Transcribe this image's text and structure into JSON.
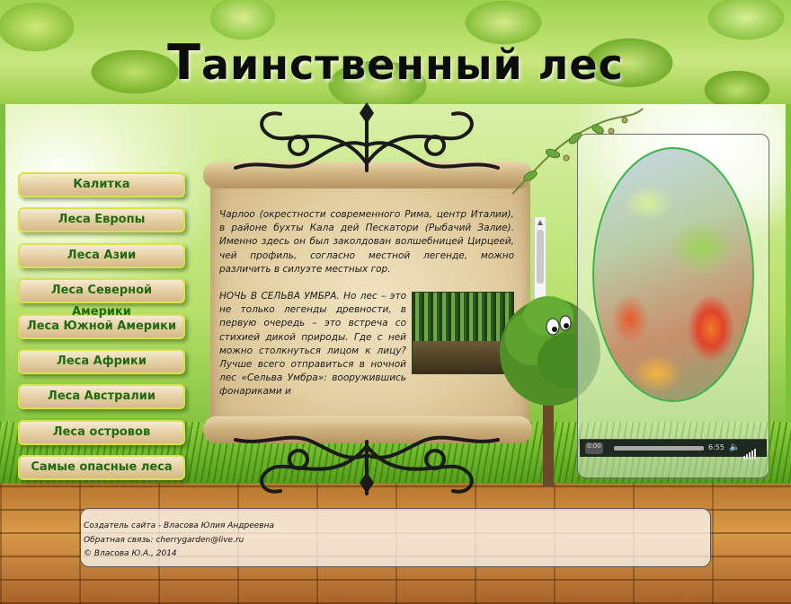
{
  "header": {
    "title_first": "Т",
    "title_rest": "аинственный лес"
  },
  "nav": {
    "items": [
      {
        "label": "Калитка"
      },
      {
        "label": "Леса Европы"
      },
      {
        "label": "Леса Азии"
      },
      {
        "label": "Леса Северной Америки"
      },
      {
        "label": "Леса Южной Америки"
      },
      {
        "label": "Леса Африки"
      },
      {
        "label": "Леса Австралии"
      },
      {
        "label": "Леса островов"
      },
      {
        "label": "Самые опасные леса"
      }
    ]
  },
  "article": {
    "p1": "Чарлоо (окрестности современного Рима, центр Италии), в районе бухты Кала дей Пескатори (Рыбачий Залие). Именно здесь он был заколдован волшебницей Цирцеей, чей профиль, согласно местной легенде, можно различить в силуэте местных гор.",
    "p2": "НОЧЬ В СЕЛЬВА УМБРА. Но лес – это не только легенды древности, в первую очередь – это встреча со стихией дикой природы. Где с ней можно столкнуться лицом к лицу? Лучше всего отправиться в ночной лес «Сельва Умбра»: вооружившись фонариками и"
  },
  "video": {
    "current_time": "0:00",
    "duration": "6:55",
    "progress": 0
  },
  "footer": {
    "author": "Создатель сайта - Власова Юлия Андреевна",
    "contact": "Обратная связь: cherrygarden@live.ru",
    "copyright": "© Власова Ю.А., 2014"
  },
  "colors": {
    "nav_text": "#1f6b12",
    "nav_border": "#d8e24a",
    "oval_border": "#39b54a"
  }
}
